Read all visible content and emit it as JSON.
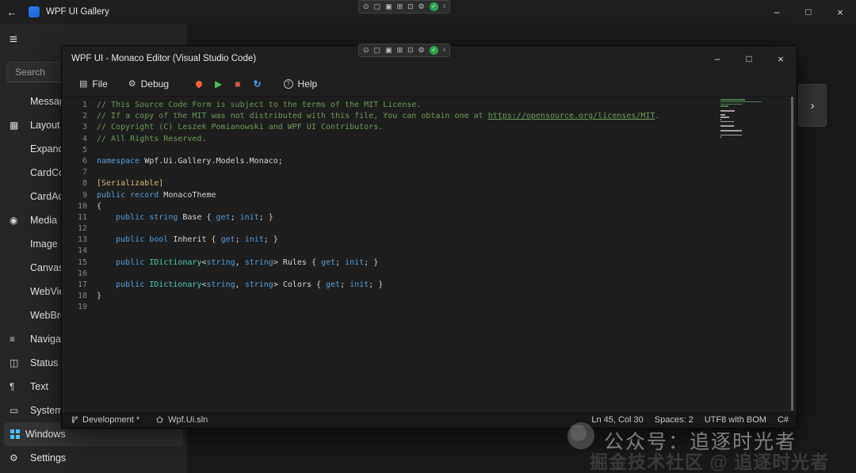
{
  "outer_window": {
    "title": "WPF UI Gallery",
    "back_icon": "←",
    "menu_icon": "≡",
    "controls": {
      "minimize": "–",
      "maximize": "□",
      "close": "×"
    },
    "search": {
      "placeholder": "Search"
    }
  },
  "sidebar": {
    "items": [
      {
        "id": "message",
        "label": "Message"
      },
      {
        "id": "layout",
        "label": "Layout",
        "icon": "▦"
      },
      {
        "id": "expander",
        "label": "Expander"
      },
      {
        "id": "card-control",
        "label": "CardControl"
      },
      {
        "id": "card-action",
        "label": "CardAction"
      },
      {
        "id": "media",
        "label": "Media",
        "icon": "◉"
      },
      {
        "id": "image",
        "label": "Image"
      },
      {
        "id": "canvas",
        "label": "Canvas"
      },
      {
        "id": "webview",
        "label": "WebView"
      },
      {
        "id": "webbrowser",
        "label": "WebBrowser"
      },
      {
        "id": "navigation",
        "label": "Navigation",
        "icon": "≡"
      },
      {
        "id": "status-info",
        "label": "Status & Info",
        "icon": "◫"
      },
      {
        "id": "text",
        "label": "Text",
        "icon": "¶"
      },
      {
        "id": "system",
        "label": "System",
        "icon": "▭"
      },
      {
        "id": "windows",
        "label": "Windows",
        "icon": "WIN",
        "selected": true
      },
      {
        "id": "settings",
        "label": "Settings",
        "icon": "⚙"
      }
    ]
  },
  "debug_toolbar": {
    "icons": [
      {
        "name": "select-element-icon",
        "glyph": "⊙"
      },
      {
        "name": "live-visual-tree-icon",
        "glyph": "▢"
      },
      {
        "name": "layout-adorners-icon",
        "glyph": "▣"
      },
      {
        "name": "grid-lines-icon",
        "glyph": "⊞"
      },
      {
        "name": "track-focus-icon",
        "glyph": "⊡"
      },
      {
        "name": "hot-reload-settings-icon",
        "glyph": "⚙"
      },
      {
        "name": "xaml-ok-icon",
        "glyph": "✓",
        "style": "ok"
      },
      {
        "name": "collapse-toolbar-icon",
        "glyph": "‹",
        "style": "chev"
      }
    ]
  },
  "flyout": {
    "chevron": "›"
  },
  "editor_window": {
    "title": "WPF UI - Monaco Editor (Visual Studio Code)",
    "controls": {
      "minimize": "–",
      "maximize": "□",
      "close": "×"
    },
    "menu": {
      "file": "File",
      "file_icon": "▤",
      "debug": "Debug",
      "debug_icon": "⚙",
      "help": "Help",
      "help_icon": "?",
      "actions": [
        {
          "name": "hot-reload-button",
          "style": "flame",
          "glyph": ""
        },
        {
          "name": "start-button",
          "style": "play",
          "glyph": "▶"
        },
        {
          "name": "stop-button",
          "style": "stop",
          "glyph": "■"
        },
        {
          "name": "restart-button",
          "style": "restart",
          "glyph": "↻"
        }
      ]
    },
    "status": {
      "branch": "Development *",
      "solution": "Wpf.Ui.sln",
      "right": [
        "Ln 45, Col 30",
        "Spaces: 2",
        "UTF8 with BOM",
        "C#"
      ]
    }
  },
  "editor": {
    "lines": [
      [
        [
          "comment",
          "// This Source Code Form is subject to the terms of the MIT License."
        ]
      ],
      [
        [
          "comment",
          "// If a copy of the MIT was not distributed with this file, You can obtain one at "
        ],
        [
          "link",
          "https://opensource.org/licenses/MIT"
        ],
        [
          "comment",
          "."
        ]
      ],
      [
        [
          "comment",
          "// Copyright (C) Leszek Pomianowski and WPF UI Contributors."
        ]
      ],
      [
        [
          "comment",
          "// All Rights Reserved."
        ]
      ],
      [],
      [
        [
          "keyword",
          "namespace"
        ],
        [
          "plain",
          " Wpf.Ui.Gallery.Models.Monaco;"
        ]
      ],
      [],
      [
        [
          "attr",
          "[Serializable]"
        ]
      ],
      [
        [
          "keyword",
          "public"
        ],
        [
          "plain",
          " "
        ],
        [
          "keyword",
          "record"
        ],
        [
          "plain",
          " MonacoTheme"
        ]
      ],
      [
        [
          "plain",
          "{"
        ]
      ],
      [
        [
          "plain",
          "    "
        ],
        [
          "keyword",
          "public"
        ],
        [
          "plain",
          " "
        ],
        [
          "keyword",
          "string"
        ],
        [
          "plain",
          " Base { "
        ],
        [
          "keyword",
          "get"
        ],
        [
          "plain",
          "; "
        ],
        [
          "keyword",
          "init"
        ],
        [
          "plain",
          "; }"
        ]
      ],
      [],
      [
        [
          "plain",
          "    "
        ],
        [
          "keyword",
          "public"
        ],
        [
          "plain",
          " "
        ],
        [
          "keyword",
          "bool"
        ],
        [
          "plain",
          " Inherit { "
        ],
        [
          "keyword",
          "get"
        ],
        [
          "plain",
          "; "
        ],
        [
          "keyword",
          "init"
        ],
        [
          "plain",
          "; }"
        ]
      ],
      [],
      [
        [
          "plain",
          "    "
        ],
        [
          "keyword",
          "public"
        ],
        [
          "plain",
          " "
        ],
        [
          "type",
          "IDictionary"
        ],
        [
          "plain",
          "<"
        ],
        [
          "keyword",
          "string"
        ],
        [
          "plain",
          ", "
        ],
        [
          "keyword",
          "string"
        ],
        [
          "plain",
          "> Rules { "
        ],
        [
          "keyword",
          "get"
        ],
        [
          "plain",
          "; "
        ],
        [
          "keyword",
          "init"
        ],
        [
          "plain",
          "; }"
        ]
      ],
      [],
      [
        [
          "plain",
          "    "
        ],
        [
          "keyword",
          "public"
        ],
        [
          "plain",
          " "
        ],
        [
          "type",
          "IDictionary"
        ],
        [
          "plain",
          "<"
        ],
        [
          "keyword",
          "string"
        ],
        [
          "plain",
          ", "
        ],
        [
          "keyword",
          "string"
        ],
        [
          "plain",
          "> Colors { "
        ],
        [
          "keyword",
          "get"
        ],
        [
          "plain",
          "; "
        ],
        [
          "keyword",
          "init"
        ],
        [
          "plain",
          "; }"
        ]
      ],
      [
        [
          "plain",
          "}"
        ]
      ],
      []
    ]
  },
  "watermark": {
    "line1": "公众号：追逐时光者",
    "line2": "掘金技术社区 @ 追逐时光者"
  }
}
